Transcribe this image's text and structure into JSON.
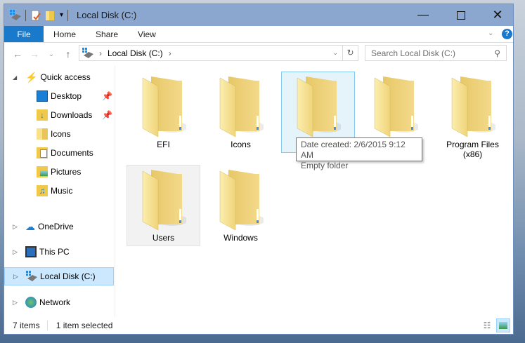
{
  "window": {
    "title": "Local Disk (C:)"
  },
  "ribbon": {
    "tabs": [
      "File",
      "Home",
      "Share",
      "View"
    ]
  },
  "address": {
    "path": "Local Disk (C:)",
    "search_placeholder": "Search Local Disk (C:)"
  },
  "sidebar": {
    "quick_access": "Quick access",
    "quick_items": [
      {
        "label": "Desktop",
        "pinned": true
      },
      {
        "label": "Downloads",
        "pinned": true
      },
      {
        "label": "Icons"
      },
      {
        "label": "Documents"
      },
      {
        "label": "Pictures"
      },
      {
        "label": "Music"
      }
    ],
    "onedrive": "OneDrive",
    "this_pc": "This PC",
    "local_disk": "Local Disk (C:)",
    "network": "Network"
  },
  "folders": [
    {
      "name": "EFI"
    },
    {
      "name": "Icons"
    },
    {
      "name": ""
    },
    {
      "name": ""
    },
    {
      "name": "Program Files (x86)"
    },
    {
      "name": "Users"
    },
    {
      "name": "Windows"
    }
  ],
  "tooltip": {
    "line1": "Date created: 2/6/2015 9:12 AM",
    "line2": "Empty folder"
  },
  "status": {
    "count": "7 items",
    "selected": "1 item selected"
  },
  "colors": {
    "titlebar": "#8ba7cf",
    "file_tab": "#1979ca",
    "selection": "#e5f3fb"
  }
}
